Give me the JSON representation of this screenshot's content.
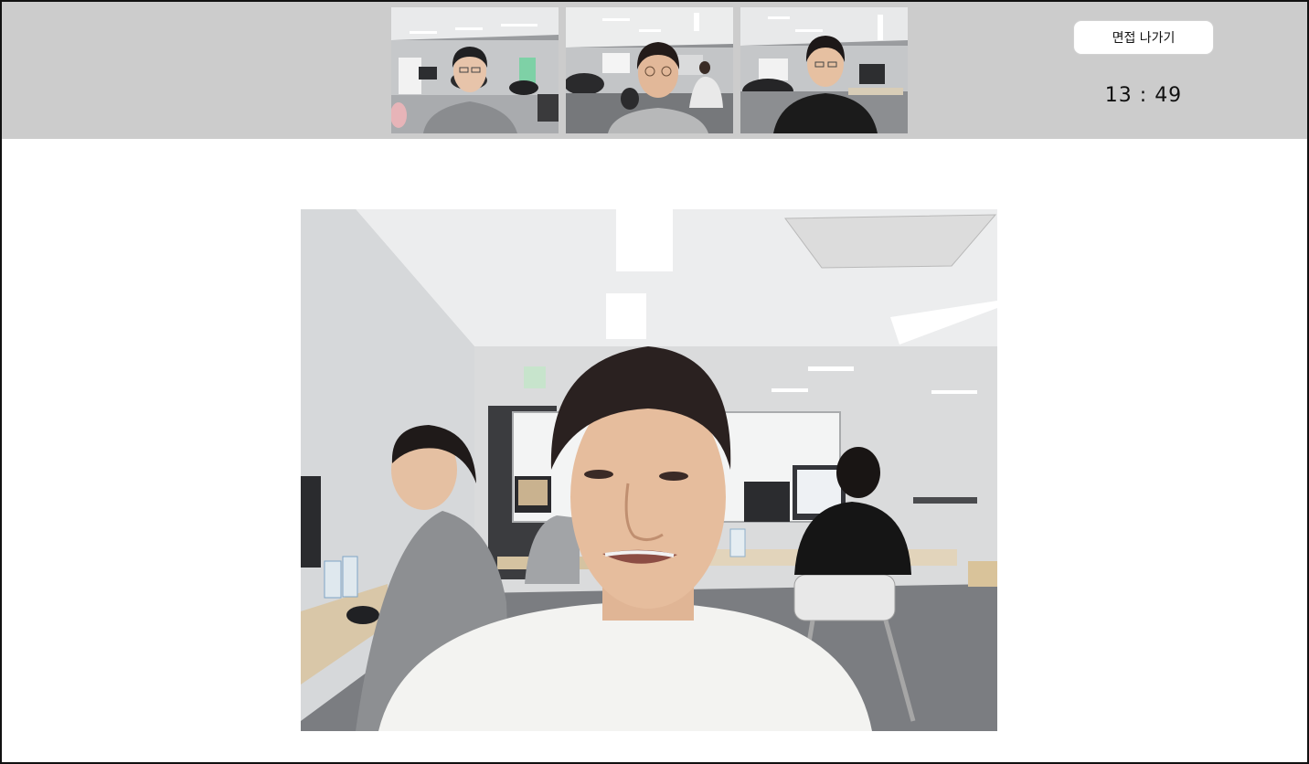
{
  "header": {
    "exit_button_label": "면접 나가기",
    "timer": "13 : 49"
  },
  "participants": [
    {
      "name": "participant-1",
      "shirt": "#8a8c8f"
    },
    {
      "name": "participant-2",
      "shirt": "#b7b8b9"
    },
    {
      "name": "participant-3",
      "shirt": "#1b1b1b"
    }
  ],
  "main_speaker": {
    "shirt": "#f3f3f1"
  },
  "colors": {
    "topbar": "#cccccc",
    "border": "#111111"
  }
}
